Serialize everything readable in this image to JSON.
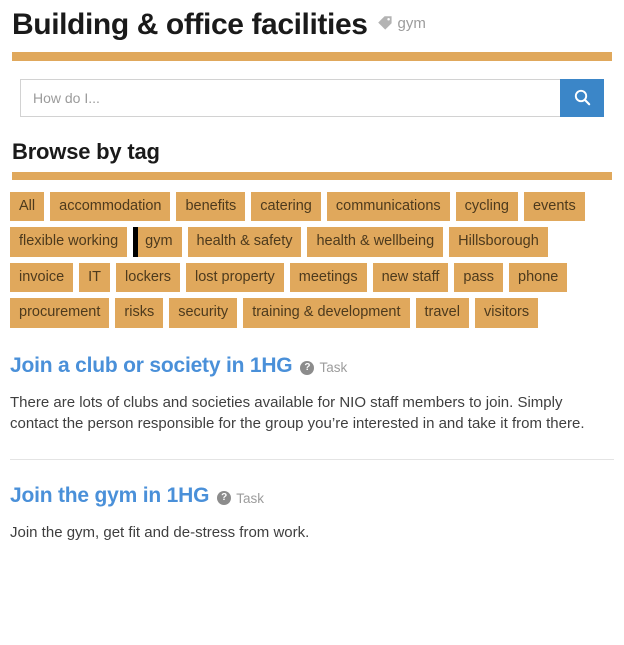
{
  "header": {
    "title": "Building & office facilities",
    "tag_icon": "tag-icon",
    "tag_label": "gym"
  },
  "search": {
    "placeholder": "How do I...",
    "value": "",
    "button_icon": "search-icon"
  },
  "browse": {
    "section_title": "Browse by tag",
    "tags": [
      {
        "label": "All",
        "active": false
      },
      {
        "label": "accommodation",
        "active": false
      },
      {
        "label": "benefits",
        "active": false
      },
      {
        "label": "catering",
        "active": false
      },
      {
        "label": "communications",
        "active": false
      },
      {
        "label": "cycling",
        "active": false
      },
      {
        "label": "events",
        "active": false
      },
      {
        "label": "flexible working",
        "active": false
      },
      {
        "label": "gym",
        "active": true
      },
      {
        "label": "health & safety",
        "active": false
      },
      {
        "label": "health & wellbeing",
        "active": false
      },
      {
        "label": "Hillsborough",
        "active": false
      },
      {
        "label": "invoice",
        "active": false
      },
      {
        "label": "IT",
        "active": false
      },
      {
        "label": "lockers",
        "active": false
      },
      {
        "label": "lost property",
        "active": false
      },
      {
        "label": "meetings",
        "active": false
      },
      {
        "label": "new staff",
        "active": false
      },
      {
        "label": "pass",
        "active": false
      },
      {
        "label": "phone",
        "active": false
      },
      {
        "label": "procurement",
        "active": false
      },
      {
        "label": "risks",
        "active": false
      },
      {
        "label": "security",
        "active": false
      },
      {
        "label": "training & development",
        "active": false
      },
      {
        "label": "travel",
        "active": false
      },
      {
        "label": "visitors",
        "active": false
      }
    ]
  },
  "articles": [
    {
      "title": "Join a club or society in 1HG",
      "badge_icon": "question-mark-icon",
      "badge_glyph": "?",
      "badge_label": "Task",
      "body": "There are lots of clubs and societies available for NIO staff members to join. Simply contact the person responsible for the group you’re interested in and take it from there."
    },
    {
      "title": "Join the gym in 1HG",
      "badge_icon": "question-mark-icon",
      "badge_glyph": "?",
      "badge_label": "Task",
      "body": "Join the gym, get fit and de-stress from work."
    }
  ],
  "colors": {
    "accent_gold": "#e0a85c",
    "link_blue": "#4a90d9",
    "button_blue": "#3b86c8",
    "muted_gray": "#9c9c9c"
  }
}
